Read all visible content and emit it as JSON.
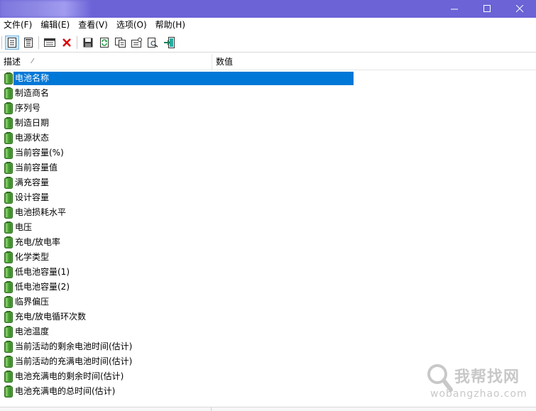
{
  "window": {
    "title": "",
    "controls": {
      "minimize": "minimize-icon",
      "maximize": "maximize-icon",
      "close": "close-icon"
    },
    "accent": "#6b63d6"
  },
  "menu": [
    "文件(F)",
    "编辑(E)",
    "查看(V)",
    "选项(O)",
    "帮助(H)"
  ],
  "toolbar": {
    "buttons": [
      {
        "name": "view-details-icon",
        "active": true
      },
      {
        "name": "view-html-icon",
        "active": false
      },
      {
        "name": "properties-icon",
        "active": false
      },
      {
        "name": "delete-icon",
        "active": false
      },
      {
        "name": "save-icon",
        "active": false
      },
      {
        "name": "refresh-icon",
        "active": false
      },
      {
        "name": "copy-icon",
        "active": false
      },
      {
        "name": "options-icon",
        "active": false
      },
      {
        "name": "find-icon",
        "active": false
      },
      {
        "name": "exit-icon",
        "active": false
      }
    ]
  },
  "table": {
    "columns": [
      "描述",
      "数值"
    ],
    "sort_indicator": "⁄",
    "selection_color": "#0078d7",
    "rows": [
      "电池名称",
      "制造商名",
      "序列号",
      "制造日期",
      "电源状态",
      "当前容量(%)",
      "当前容量值",
      "满充容量",
      "设计容量",
      "电池损耗水平",
      "电压",
      "充电/放电率",
      "化学类型",
      "低电池容量(1)",
      "低电池容量(2)",
      "临界偏压",
      "充电/放电循环次数",
      "电池温度",
      "当前活动的剩余电池时间(估计)",
      "当前活动的充满电池时间(估计)",
      "电池充满电的剩余时间(估计)",
      "电池充满电的总时间(估计)"
    ],
    "selected_index": 0
  },
  "watermark": {
    "text": "我帮找网",
    "sub": "wobangzhao.com"
  }
}
